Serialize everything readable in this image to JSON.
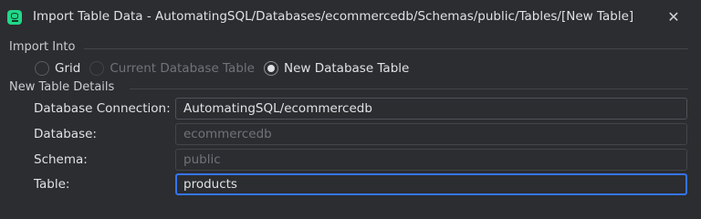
{
  "window": {
    "title": "Import Table Data - AutomatingSQL/Databases/ecommercedb/Schemas/public/Tables/[New Table]",
    "icon": "datagrip-app-icon",
    "close_glyph": "✕"
  },
  "import_into": {
    "label": "Import Into",
    "options": [
      {
        "label": "Grid",
        "checked": false,
        "enabled": true
      },
      {
        "label": "Current Database Table",
        "checked": false,
        "enabled": false
      },
      {
        "label": "New Database Table",
        "checked": true,
        "enabled": true
      }
    ]
  },
  "new_table_details": {
    "label": "New Table Details",
    "fields": {
      "connection": {
        "label": "Database Connection:",
        "value": "AutomatingSQL/ecommercedb"
      },
      "database": {
        "label": "Database:",
        "value": "ecommercedb"
      },
      "schema": {
        "label": "Schema:",
        "value": "public"
      },
      "table": {
        "label": "Table:",
        "value": "products"
      }
    }
  },
  "colors": {
    "background": "#2b2d30",
    "focus_accent": "#3574f0",
    "app_icon": "#21d789"
  }
}
